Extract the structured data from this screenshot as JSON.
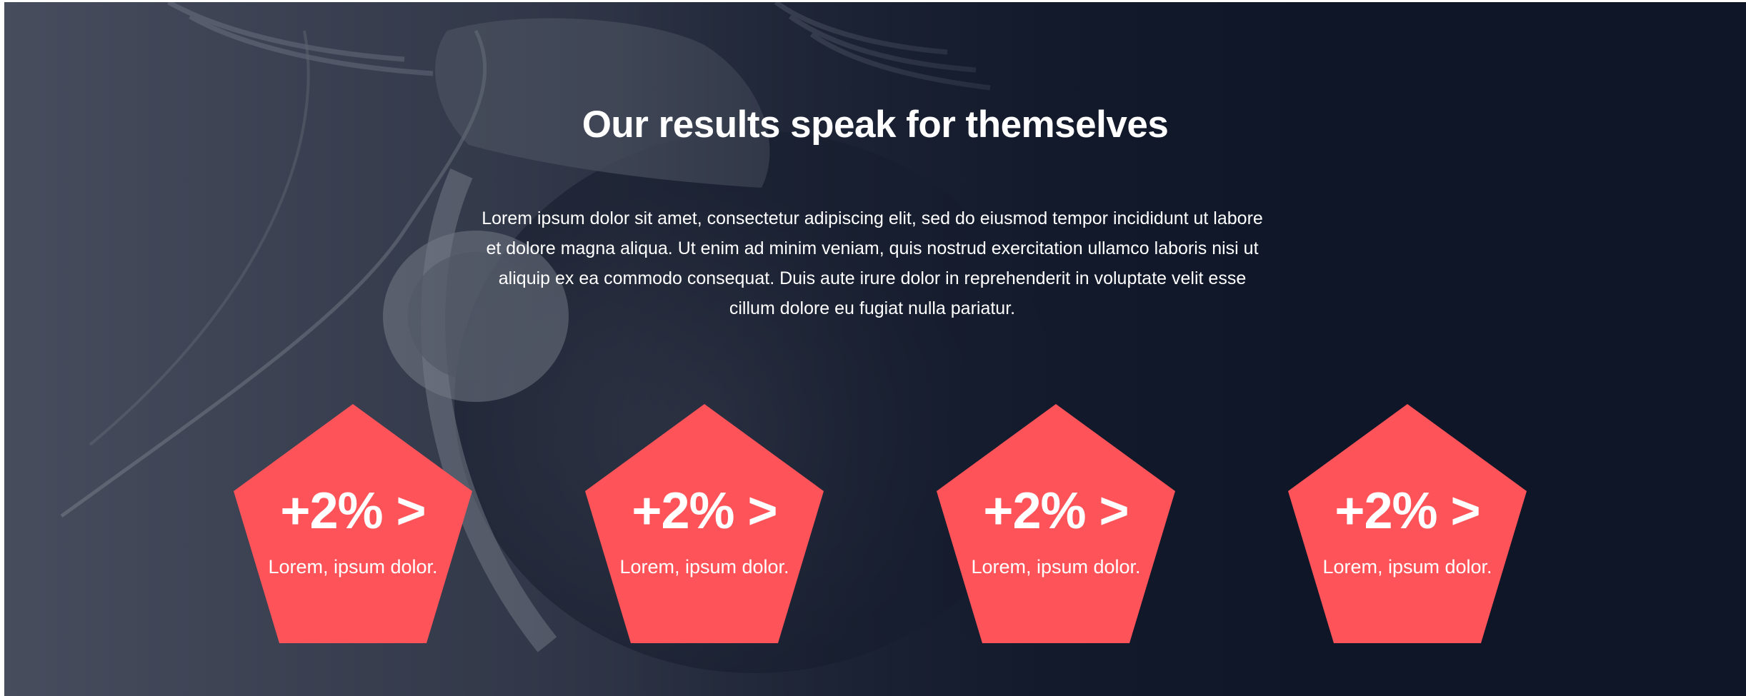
{
  "section": {
    "heading": "Our results speak for themselves",
    "intro": "Lorem ipsum dolor sit amet, consectetur adipiscing elit, sed do eiusmod tempor incididunt ut labore et dolore magna aliqua. Ut enim ad minim veniam, quis nostrud exercitation ullamco laboris nisi ut aliquip ex ea commodo consequat. Duis aute irure dolor in reprehenderit in voluptate velit esse cillum dolore eu fugiat nulla pariatur.",
    "background_image": "woman-with-headphones-photo"
  },
  "stats": [
    {
      "value": "+2% >",
      "label": "Lorem, ipsum dolor."
    },
    {
      "value": "+2% >",
      "label": "Lorem, ipsum dolor."
    },
    {
      "value": "+2% >",
      "label": "Lorem, ipsum dolor."
    },
    {
      "value": "+2% >",
      "label": "Lorem, ipsum dolor."
    }
  ],
  "colors": {
    "background": "#0e1628",
    "accent": "#fe5459",
    "text": "#ffffff"
  }
}
